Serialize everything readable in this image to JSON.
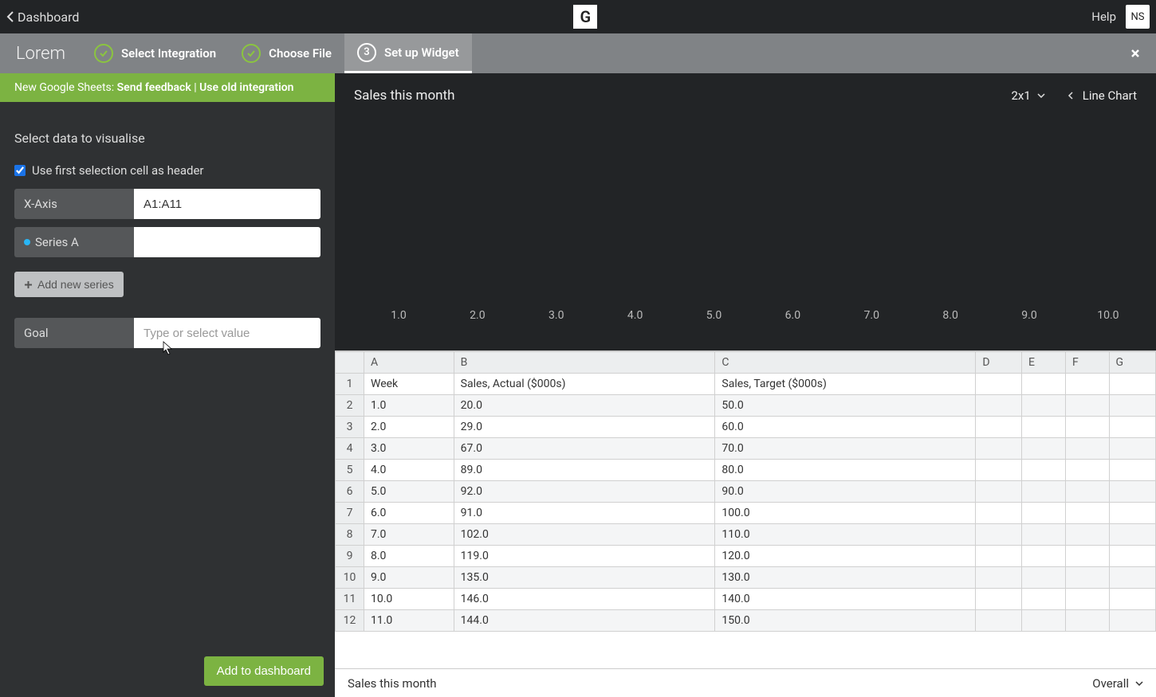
{
  "topbar": {
    "back_label": "Dashboard",
    "logo": "G",
    "help": "Help",
    "avatar": "NS"
  },
  "stepsbar": {
    "brand": "Lorem",
    "step1": "Select Integration",
    "step2": "Choose File",
    "step3_num": "3",
    "step3": "Set up Widget"
  },
  "banner": {
    "prefix": "New Google Sheets: ",
    "link1": "Send feedback",
    "sep": " | ",
    "link2": "Use old integration"
  },
  "sidebar": {
    "title": "Select data to visualise",
    "checkbox_label": "Use first selection cell as header",
    "xaxis_label": "X-Axis",
    "xaxis_value": "A1:A11",
    "seriesA_label": "Series A",
    "seriesA_value": "",
    "add_series": "Add new series",
    "goal_label": "Goal",
    "goal_placeholder": "Type or select value",
    "add_to_dashboard": "Add to dashboard"
  },
  "chart": {
    "title": "Sales this month",
    "size": "2x1",
    "type": "Line Chart"
  },
  "chart_data": {
    "type": "line",
    "title": "Sales this month",
    "x": [
      "1.0",
      "2.0",
      "3.0",
      "4.0",
      "5.0",
      "6.0",
      "7.0",
      "8.0",
      "9.0",
      "10.0"
    ],
    "series": [],
    "xlabel": "",
    "ylabel": ""
  },
  "sheet": {
    "columns": [
      "A",
      "B",
      "C",
      "D",
      "E",
      "F",
      "G"
    ],
    "rows": [
      {
        "n": "1",
        "cells": [
          "Week",
          "Sales, Actual ($000s)",
          "Sales, Target ($000s)",
          "",
          "",
          "",
          ""
        ]
      },
      {
        "n": "2",
        "cells": [
          "1.0",
          "20.0",
          "50.0",
          "",
          "",
          "",
          ""
        ]
      },
      {
        "n": "3",
        "cells": [
          "2.0",
          "29.0",
          "60.0",
          "",
          "",
          "",
          ""
        ]
      },
      {
        "n": "4",
        "cells": [
          "3.0",
          "67.0",
          "70.0",
          "",
          "",
          "",
          ""
        ]
      },
      {
        "n": "5",
        "cells": [
          "4.0",
          "89.0",
          "80.0",
          "",
          "",
          "",
          ""
        ]
      },
      {
        "n": "6",
        "cells": [
          "5.0",
          "92.0",
          "90.0",
          "",
          "",
          "",
          ""
        ]
      },
      {
        "n": "7",
        "cells": [
          "6.0",
          "91.0",
          "100.0",
          "",
          "",
          "",
          ""
        ]
      },
      {
        "n": "8",
        "cells": [
          "7.0",
          "102.0",
          "110.0",
          "",
          "",
          "",
          ""
        ]
      },
      {
        "n": "9",
        "cells": [
          "8.0",
          "119.0",
          "120.0",
          "",
          "",
          "",
          ""
        ]
      },
      {
        "n": "10",
        "cells": [
          "9.0",
          "135.0",
          "130.0",
          "",
          "",
          "",
          ""
        ]
      },
      {
        "n": "11",
        "cells": [
          "10.0",
          "146.0",
          "140.0",
          "",
          "",
          "",
          ""
        ]
      },
      {
        "n": "12",
        "cells": [
          "11.0",
          "144.0",
          "150.0",
          "",
          "",
          "",
          ""
        ]
      }
    ]
  },
  "bottombar": {
    "sheet_name": "Sales this month",
    "overall": "Overall"
  }
}
